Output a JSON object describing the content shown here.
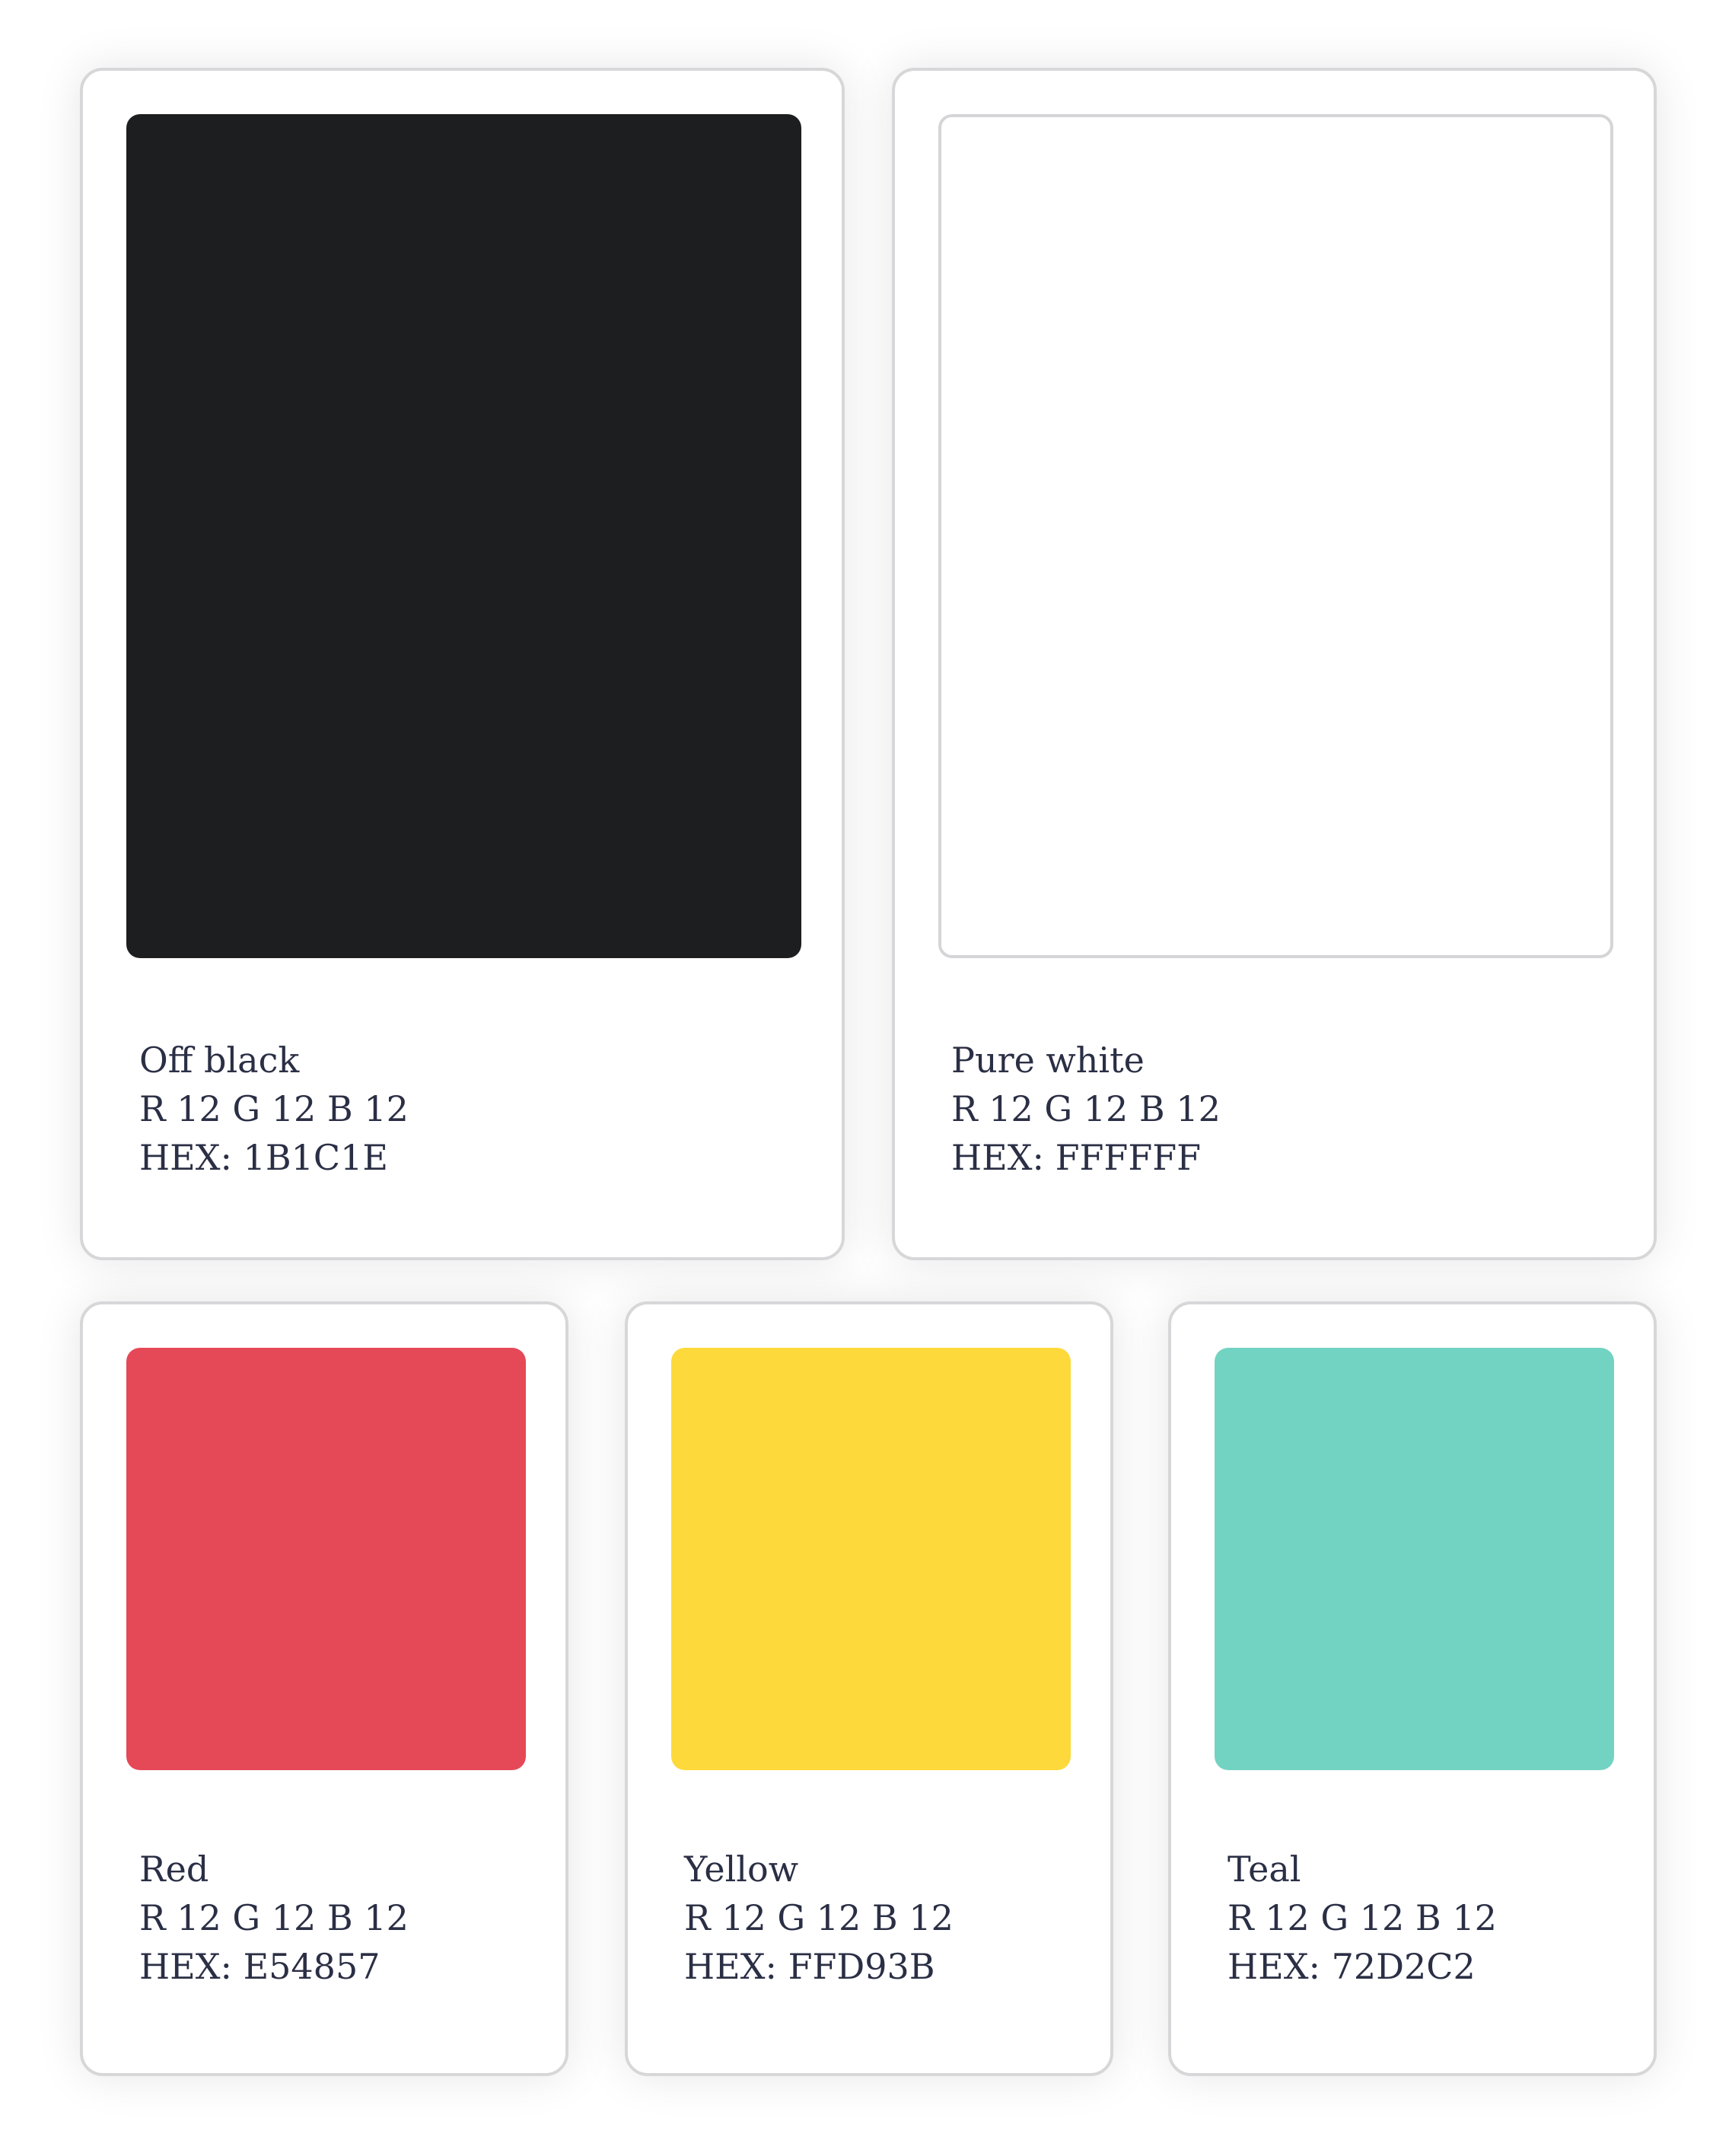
{
  "colors": [
    {
      "name": "Off black",
      "rgb": "R 12 G 12 B 12",
      "hex": "HEX: 1B1C1E",
      "swatch": "#1D1E20"
    },
    {
      "name": "Pure white",
      "rgb": "R 12 G 12 B 12",
      "hex": "HEX: FFFFFF",
      "swatch": "#FFFFFF"
    },
    {
      "name": "Red",
      "rgb": "R 12 G 12 B 12",
      "hex": "HEX: E54857",
      "swatch": "#E54857"
    },
    {
      "name": "Yellow",
      "rgb": "R 12 G 12 B 12",
      "hex": "HEX: FFD93B",
      "swatch": "#FDD93B"
    },
    {
      "name": "Teal",
      "rgb": "R 12 G 12 B 12",
      "hex": "HEX: 72D2C2",
      "swatch": "#73D3C2"
    }
  ]
}
